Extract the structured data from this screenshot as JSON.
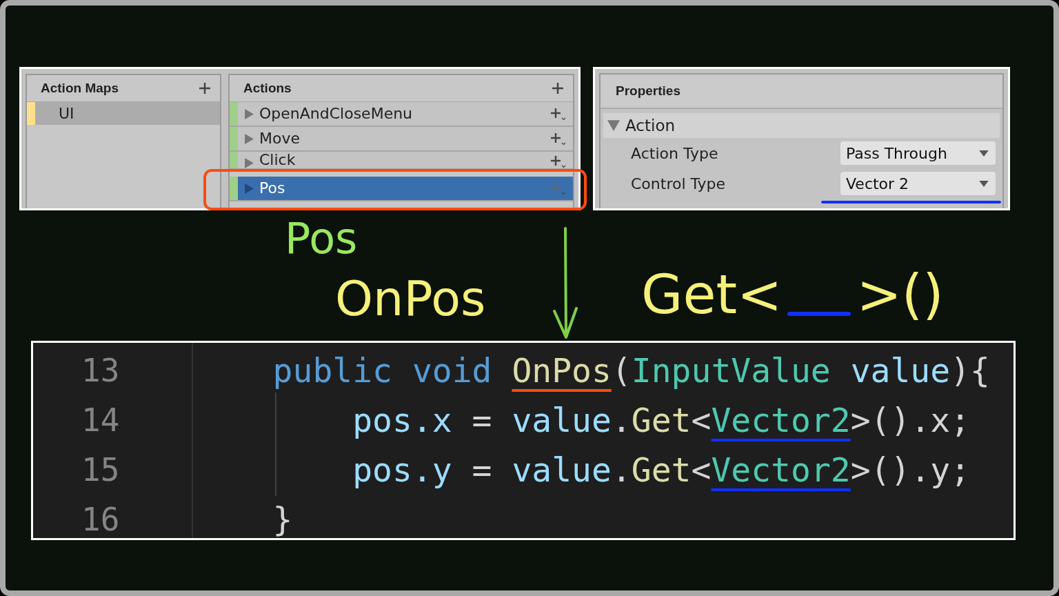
{
  "action_maps": {
    "title": "Action Maps",
    "items": [
      {
        "label": "UI",
        "selected": true
      }
    ]
  },
  "actions": {
    "title": "Actions",
    "items": [
      {
        "label": "OpenAndCloseMenu",
        "selected": false,
        "highlighted": false
      },
      {
        "label": "Move",
        "selected": false,
        "highlighted": false
      },
      {
        "label": "Click",
        "selected": false,
        "highlighted": false
      },
      {
        "label": "Pos",
        "selected": true,
        "highlighted": true
      }
    ]
  },
  "properties": {
    "title": "Properties",
    "section": {
      "title": "Action",
      "expanded": true,
      "fields": [
        {
          "label": "Action Type",
          "value": "Pass Through",
          "underlined": false
        },
        {
          "label": "Control Type",
          "value": "Vector 2",
          "underlined": true
        }
      ]
    }
  },
  "annotations": {
    "action_name": "Pos",
    "method_name": "OnPos",
    "get_prefix": "Get<",
    "get_suffix": ">()"
  },
  "code": {
    "lines": [
      {
        "number": "13",
        "tokens": [
          {
            "text": "    public void ",
            "kind": "keyword",
            "underlined": false
          },
          {
            "text": "OnPos",
            "kind": "method",
            "underlined": true
          },
          {
            "text": "(",
            "kind": "plain",
            "underlined": false
          },
          {
            "text": "InputValue",
            "kind": "type",
            "underlined": false
          },
          {
            "text": " value",
            "kind": "variable",
            "underlined": false
          },
          {
            "text": "){",
            "kind": "plain",
            "underlined": false
          }
        ]
      },
      {
        "number": "14",
        "tokens": [
          {
            "text": "        pos.x",
            "kind": "variable",
            "underlined": false
          },
          {
            "text": " = ",
            "kind": "plain",
            "underlined": false
          },
          {
            "text": "value",
            "kind": "variable",
            "underlined": false
          },
          {
            "text": ".",
            "kind": "plain",
            "underlined": false
          },
          {
            "text": "Get",
            "kind": "method",
            "underlined": false
          },
          {
            "text": "<",
            "kind": "plain",
            "underlined": false
          },
          {
            "text": "Vector2",
            "kind": "type",
            "underlined": true
          },
          {
            "text": ">().x;",
            "kind": "plain",
            "underlined": false
          }
        ]
      },
      {
        "number": "15",
        "tokens": [
          {
            "text": "        pos.y",
            "kind": "variable",
            "underlined": false
          },
          {
            "text": " = ",
            "kind": "plain",
            "underlined": false
          },
          {
            "text": "value",
            "kind": "variable",
            "underlined": false
          },
          {
            "text": ".",
            "kind": "plain",
            "underlined": false
          },
          {
            "text": "Get",
            "kind": "method",
            "underlined": false
          },
          {
            "text": "<",
            "kind": "plain",
            "underlined": false
          },
          {
            "text": "Vector2",
            "kind": "type",
            "underlined": true
          },
          {
            "text": ">().y;",
            "kind": "plain",
            "underlined": false
          }
        ]
      },
      {
        "number": "16",
        "tokens": [
          {
            "text": "    }",
            "kind": "plain",
            "underlined": false
          }
        ]
      }
    ]
  }
}
